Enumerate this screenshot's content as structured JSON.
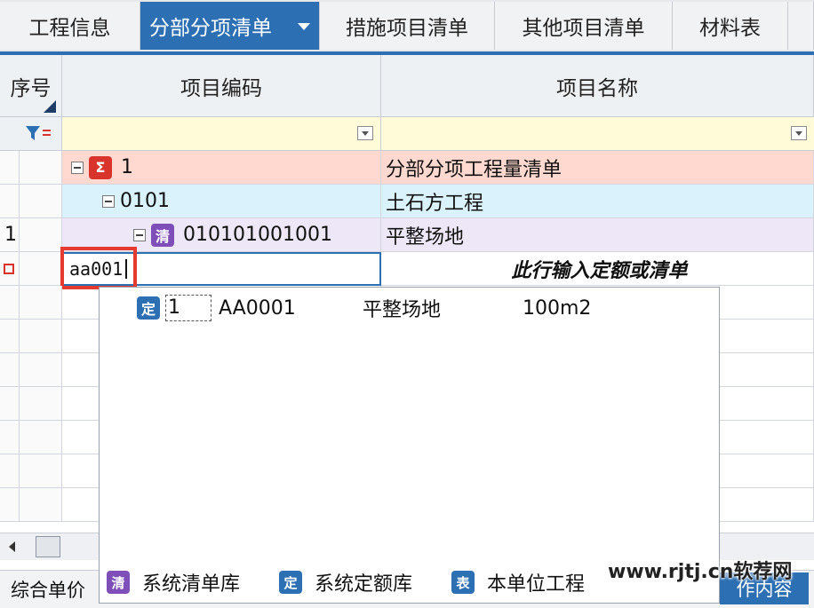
{
  "tabs": [
    {
      "label": "工程信息"
    },
    {
      "label": "分部分项清单"
    },
    {
      "label": "措施项目清单"
    },
    {
      "label": "其他项目清单"
    },
    {
      "label": "材料表"
    }
  ],
  "columns": {
    "seq": "序号",
    "code": "项目编码",
    "name": "项目名称"
  },
  "rows": [
    {
      "seq": "",
      "code": "1",
      "name": "分部分项工程量清单",
      "icon": "Σ"
    },
    {
      "seq": "",
      "code": "0101",
      "name": "土石方工程"
    },
    {
      "seq": "1",
      "code": "010101001001",
      "name": "平整场地",
      "icon": "清"
    }
  ],
  "input_row": {
    "value": "aa001",
    "hint": "此行输入定额或清单"
  },
  "popup": {
    "items": [
      {
        "icon": "定",
        "no": "1",
        "code": "AA0001",
        "name": "平整场地",
        "unit": "100m2"
      }
    ],
    "footer": [
      {
        "icon": "清",
        "label": "系统清单库"
      },
      {
        "icon": "定",
        "label": "系统定额库"
      },
      {
        "icon": "表",
        "label": "本单位工程"
      }
    ]
  },
  "bottom": {
    "left_label": "综合单价",
    "right_label": "作内容"
  },
  "watermark": "www.rjtj.cn软荐网",
  "colors": {
    "accent": "#2d6fb3",
    "row_level1": "#ffd9cf",
    "row_level2": "#d9f2fb",
    "row_level3": "#eee7f7",
    "filter_row": "#fffbd8"
  }
}
